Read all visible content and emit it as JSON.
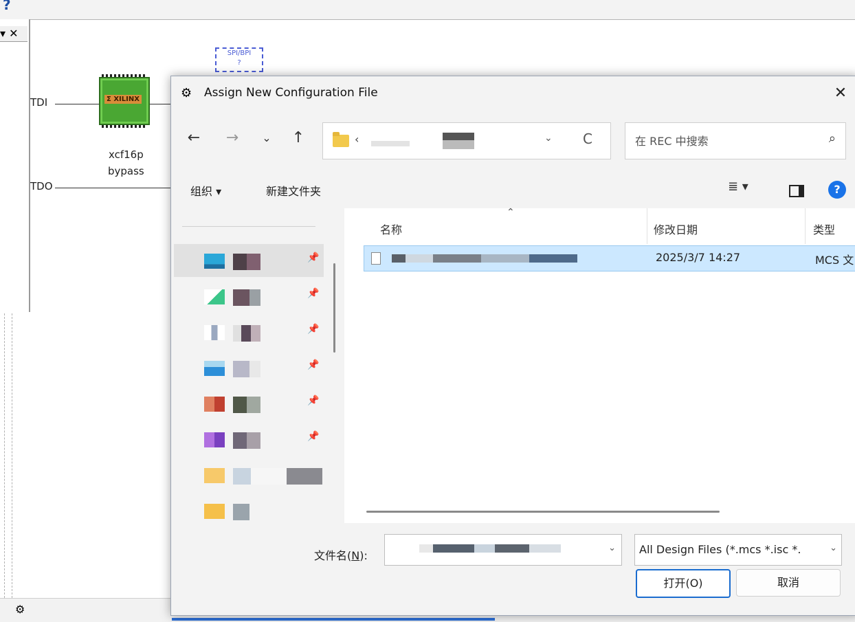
{
  "canvas": {
    "tdi_label": "TDI",
    "tdo_label": "TDO",
    "chip_brand": "Σ XILINX",
    "chip_part": "xcf16p",
    "chip_mode": "bypass",
    "spi_label": "SPI/BPI",
    "spi_mark": "?",
    "pane_controls": "▾ ✕"
  },
  "dialog": {
    "title": "Assign New Configuration File",
    "close_glyph": "✕",
    "nav": {
      "back": "←",
      "forward": "→",
      "recent": "⌄",
      "up": "↑",
      "refresh": "C",
      "addr_dropdown": "⌄"
    },
    "address_prefix": "‹",
    "search_placeholder": "在 REC 中搜索",
    "search_icon": "⌕",
    "toolbar": {
      "organize": "组织 ▾",
      "new_folder": "新建文件夹",
      "view_glyph": "≣ ▾",
      "help_glyph": "?"
    },
    "columns": {
      "name": "名称",
      "sort_glyph": "⌃",
      "modified": "修改日期",
      "type": "类型"
    },
    "selected_file": {
      "modified": "2025/3/7 14:27",
      "type": "MCS 文"
    },
    "filename_label_pre": "文件名(",
    "filename_label_key": "N",
    "filename_label_post": "):",
    "filter": "All Design Files (*.mcs *.isc *.",
    "dropdown_glyph": "⌄",
    "open_btn": "打开(O)",
    "cancel_btn": "取消"
  }
}
